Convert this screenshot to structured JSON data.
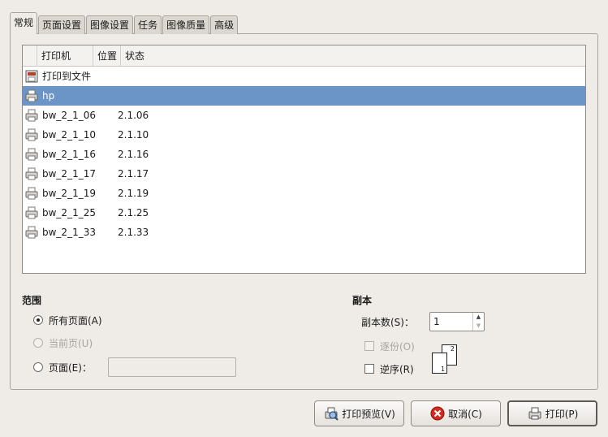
{
  "tabs": [
    "常规",
    "页面设置",
    "图像设置",
    "任务",
    "图像质量",
    "高级"
  ],
  "printer_list": {
    "columns": [
      "打印机",
      "位置",
      "状态"
    ],
    "rows": [
      {
        "name": "打印到文件",
        "location": "",
        "icon": "print-to-file-icon",
        "selected": false
      },
      {
        "name": "hp",
        "location": "",
        "icon": "printer-icon",
        "selected": true
      },
      {
        "name": "bw_2_1_06",
        "location": "2.1.06",
        "icon": "printer-icon",
        "selected": false
      },
      {
        "name": "bw_2_1_10",
        "location": "2.1.10",
        "icon": "printer-icon",
        "selected": false
      },
      {
        "name": "bw_2_1_16",
        "location": "2.1.16",
        "icon": "printer-icon",
        "selected": false
      },
      {
        "name": "bw_2_1_17",
        "location": "2.1.17",
        "icon": "printer-icon",
        "selected": false
      },
      {
        "name": "bw_2_1_19",
        "location": "2.1.19",
        "icon": "printer-icon",
        "selected": false
      },
      {
        "name": "bw_2_1_25",
        "location": "2.1.25",
        "icon": "printer-icon",
        "selected": false
      },
      {
        "name": "bw_2_1_33",
        "location": "2.1.33",
        "icon": "printer-icon",
        "selected": false
      }
    ]
  },
  "range": {
    "title": "范围",
    "all_pages": "所有页面(A)",
    "current_page": "当前页(U)",
    "pages": "页面(E)：",
    "pages_value": ""
  },
  "copies": {
    "title": "副本",
    "count_label": "副本数(S)：",
    "count_value": "1",
    "collate": "逐份(O)",
    "reverse": "逆序(R)",
    "page_labels": [
      "1",
      "2"
    ]
  },
  "buttons": {
    "preview": "打印预览(V)",
    "cancel": "取消(C)",
    "print": "打印(P)"
  },
  "colors": {
    "selection": "#6b95c7",
    "background": "#efebe7"
  }
}
